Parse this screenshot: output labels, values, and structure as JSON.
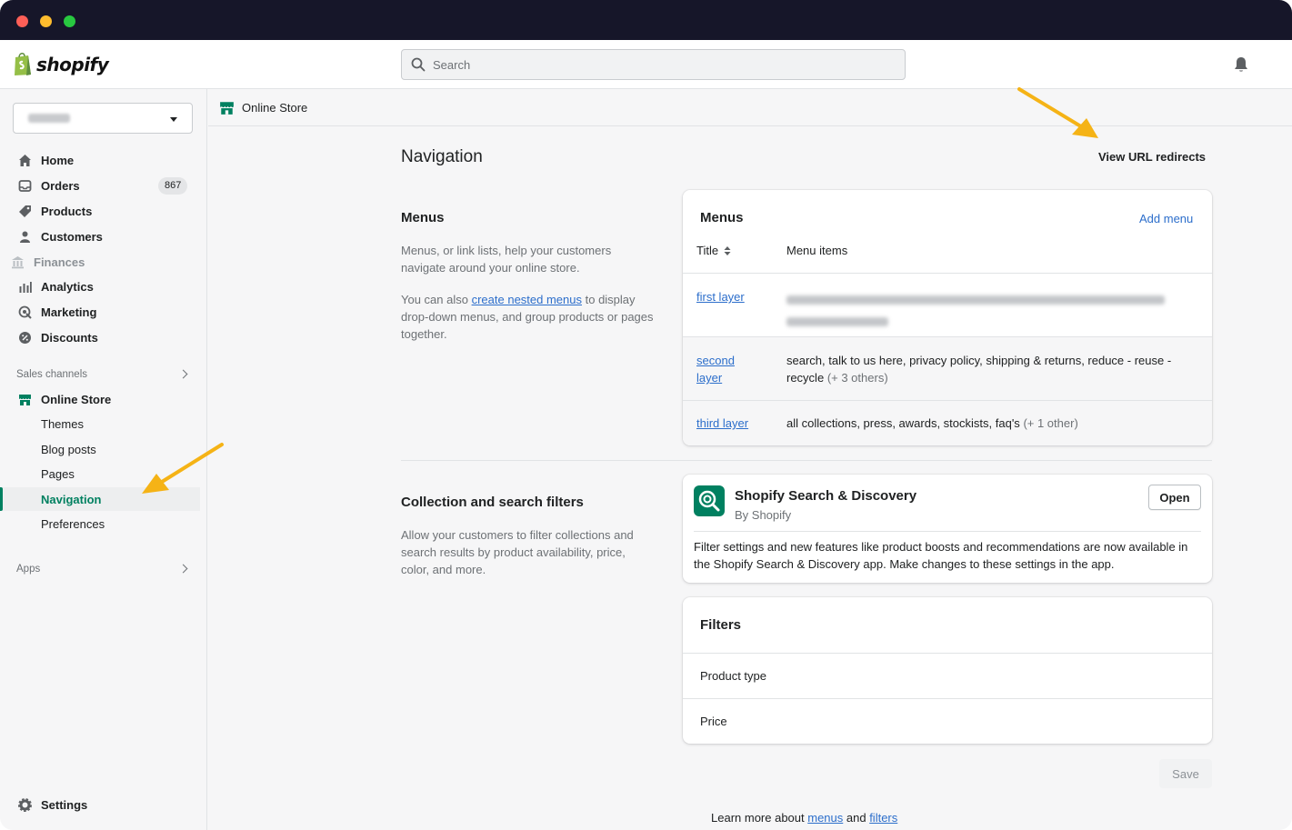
{
  "app": {
    "logo_text": "shopify"
  },
  "search": {
    "placeholder": "Search"
  },
  "sidebar": {
    "items": [
      {
        "label": "Home",
        "icon": "home-icon"
      },
      {
        "label": "Orders",
        "icon": "orders-icon",
        "badge": "867"
      },
      {
        "label": "Products",
        "icon": "tag-icon"
      },
      {
        "label": "Customers",
        "icon": "person-icon"
      },
      {
        "label": "Finances",
        "icon": "bank-icon"
      },
      {
        "label": "Analytics",
        "icon": "bar-chart-icon"
      },
      {
        "label": "Marketing",
        "icon": "target-icon"
      },
      {
        "label": "Discounts",
        "icon": "discount-icon"
      }
    ],
    "sales_channels_label": "Sales channels",
    "online_store": {
      "label": "Online Store",
      "sub_items": [
        "Themes",
        "Blog posts",
        "Pages",
        "Navigation",
        "Preferences"
      ],
      "active": "Navigation"
    },
    "apps_label": "Apps",
    "settings_label": "Settings"
  },
  "breadcrumb": {
    "label": "Online Store"
  },
  "page": {
    "title": "Navigation",
    "view_redirects": "View URL redirects"
  },
  "menus_section": {
    "title": "Menus",
    "desc1": "Menus, or link lists, help your customers navigate around your online store.",
    "desc2_pre": "You can also ",
    "desc2_link": "create nested menus",
    "desc2_post": " to display drop-down menus, and group products or pages together.",
    "card_title": "Menus",
    "add_menu": "Add menu",
    "col_title": "Title",
    "col_items": "Menu items",
    "rows": [
      {
        "title": "first layer",
        "items": "",
        "others": ""
      },
      {
        "title": "second layer",
        "items": "search, talk to us here, privacy policy, shipping & returns, reduce - reuse - recycle",
        "others": "(+ 3 others)"
      },
      {
        "title": "third layer",
        "items": "all collections, press, awards, stockists, faq's",
        "others": "(+ 1 other)"
      }
    ]
  },
  "filters_section": {
    "title": "Collection and search filters",
    "desc": "Allow your customers to filter collections and search results by product availability, price, color, and more.",
    "app_name": "Shopify Search & Discovery",
    "app_by": "By Shopify",
    "open_label": "Open",
    "app_desc": "Filter settings and new features like product boosts and recommendations are now available in the Shopify Search & Discovery app. Make changes to these settings in the app.",
    "filters_title": "Filters",
    "filters": [
      "Product type",
      "Price"
    ]
  },
  "save_label": "Save",
  "footer": {
    "pre": "Learn more about ",
    "link1": "menus",
    "mid": " and ",
    "link2": "filters"
  },
  "colors": {
    "accent": "#008060",
    "link": "#2c6ecb",
    "arrow": "#f5b316",
    "titlebar": "#161629"
  }
}
